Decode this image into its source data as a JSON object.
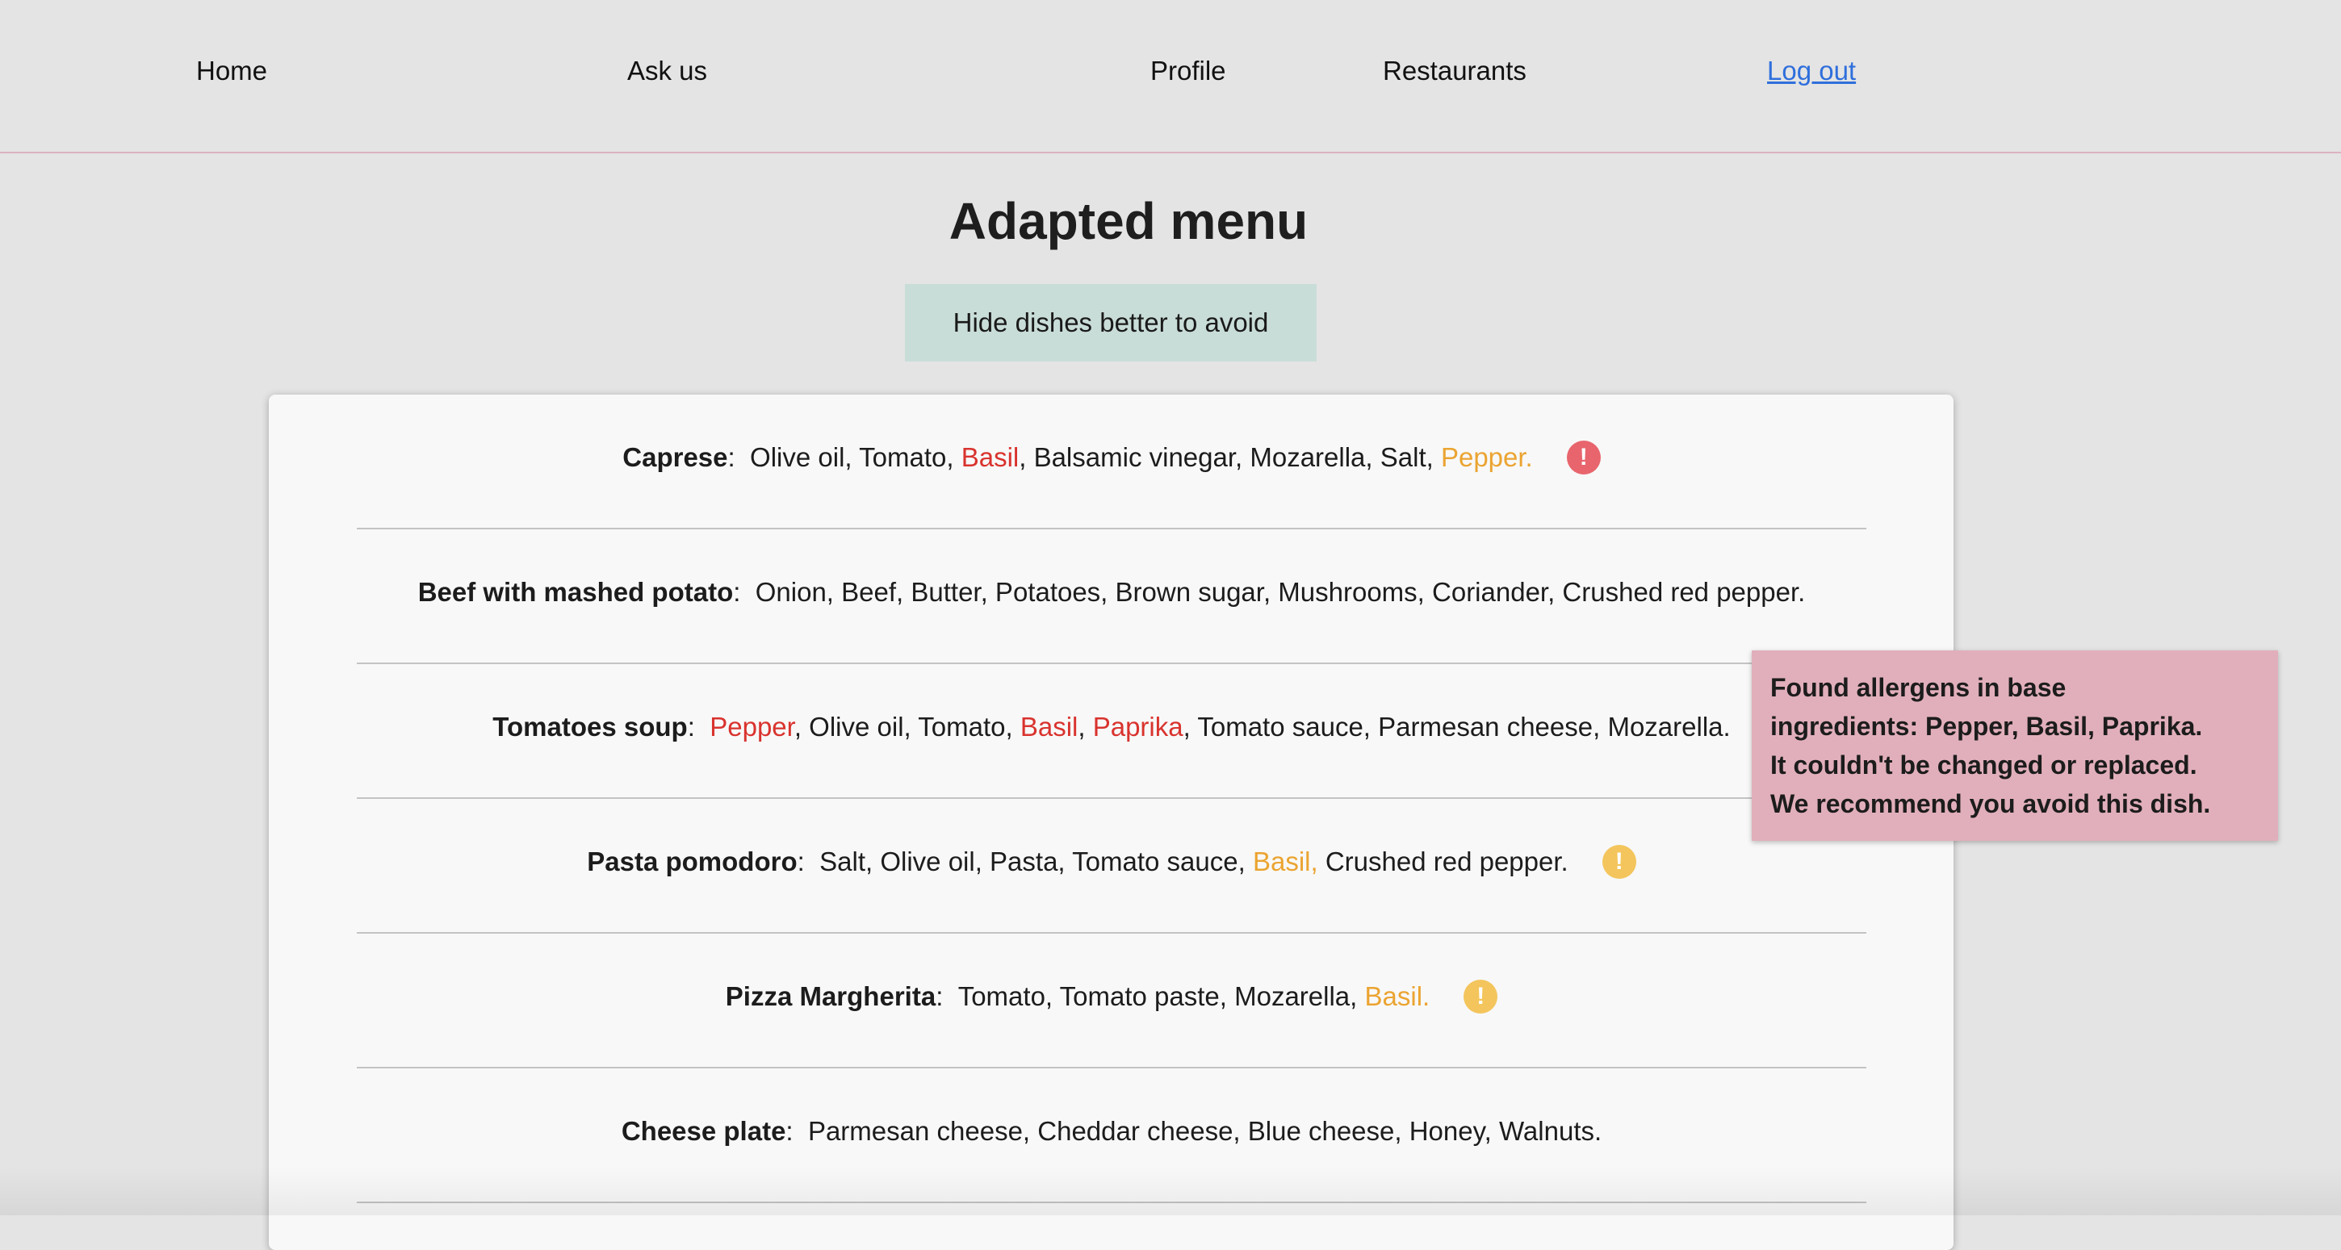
{
  "nav": {
    "home": "Home",
    "ask_us": "Ask us",
    "profile": "Profile",
    "restaurants": "Restaurants",
    "logout": "Log out"
  },
  "page": {
    "title": "Adapted menu",
    "hide_button": "Hide dishes better to avoid"
  },
  "colors": {
    "background": "#e4e4e4",
    "allergen_red": "#d9332e",
    "allergen_orange": "#eba431",
    "warning_red_icon": "#e8656d",
    "warning_orange_icon": "#f3c55c",
    "tooltip_background": "#e1afbb",
    "button_background": "#c9ddd8",
    "link": "#2f6fdc"
  },
  "dishes": [
    {
      "name": "Caprese",
      "ingredients": [
        {
          "text": "Olive oil, Tomato, "
        },
        {
          "text": "Basil",
          "severity": "red"
        },
        {
          "text": ", Balsamic vinegar, Mozarella, Salt, "
        },
        {
          "text": "Pepper.",
          "severity": "orange"
        }
      ],
      "warning": {
        "level": "red",
        "icon": "exclamation-circle-icon",
        "glyph": "!"
      }
    },
    {
      "name": "Beef with mashed potato",
      "ingredients": [
        {
          "text": "Onion, Beef, Butter, Potatoes, Brown sugar, Mushrooms, Coriander, Crushed red pepper."
        }
      ]
    },
    {
      "name": "Tomatoes soup",
      "ingredients": [
        {
          "text": "Pepper",
          "severity": "red"
        },
        {
          "text": ", Olive oil, Tomato, "
        },
        {
          "text": "Basil",
          "severity": "red"
        },
        {
          "text": ", "
        },
        {
          "text": "Paprika",
          "severity": "red"
        },
        {
          "text": ", Tomato sauce, Parmesan cheese, Mozarella."
        }
      ]
    },
    {
      "name": "Pasta pomodoro",
      "ingredients": [
        {
          "text": "Salt, Olive oil, Pasta, Tomato sauce, "
        },
        {
          "text": "Basil,",
          "severity": "orange"
        },
        {
          "text": " Crushed red pepper."
        }
      ],
      "warning": {
        "level": "orange",
        "icon": "exclamation-circle-icon",
        "glyph": "!"
      }
    },
    {
      "name": "Pizza Margherita",
      "ingredients": [
        {
          "text": "Tomato, Tomato paste, Mozarella, "
        },
        {
          "text": "Basil.",
          "severity": "orange"
        }
      ],
      "warning": {
        "level": "orange",
        "icon": "exclamation-circle-icon",
        "glyph": "!"
      }
    },
    {
      "name": "Cheese plate",
      "ingredients": [
        {
          "text": "Parmesan cheese, Cheddar cheese, Blue cheese, Honey, Walnuts."
        }
      ]
    }
  ],
  "tooltip": {
    "lines": [
      "Found allergens in base",
      "ingredients: Pepper, Basil, Paprika.",
      "It couldn't be changed or replaced.",
      "We recommend you avoid this dish."
    ]
  }
}
